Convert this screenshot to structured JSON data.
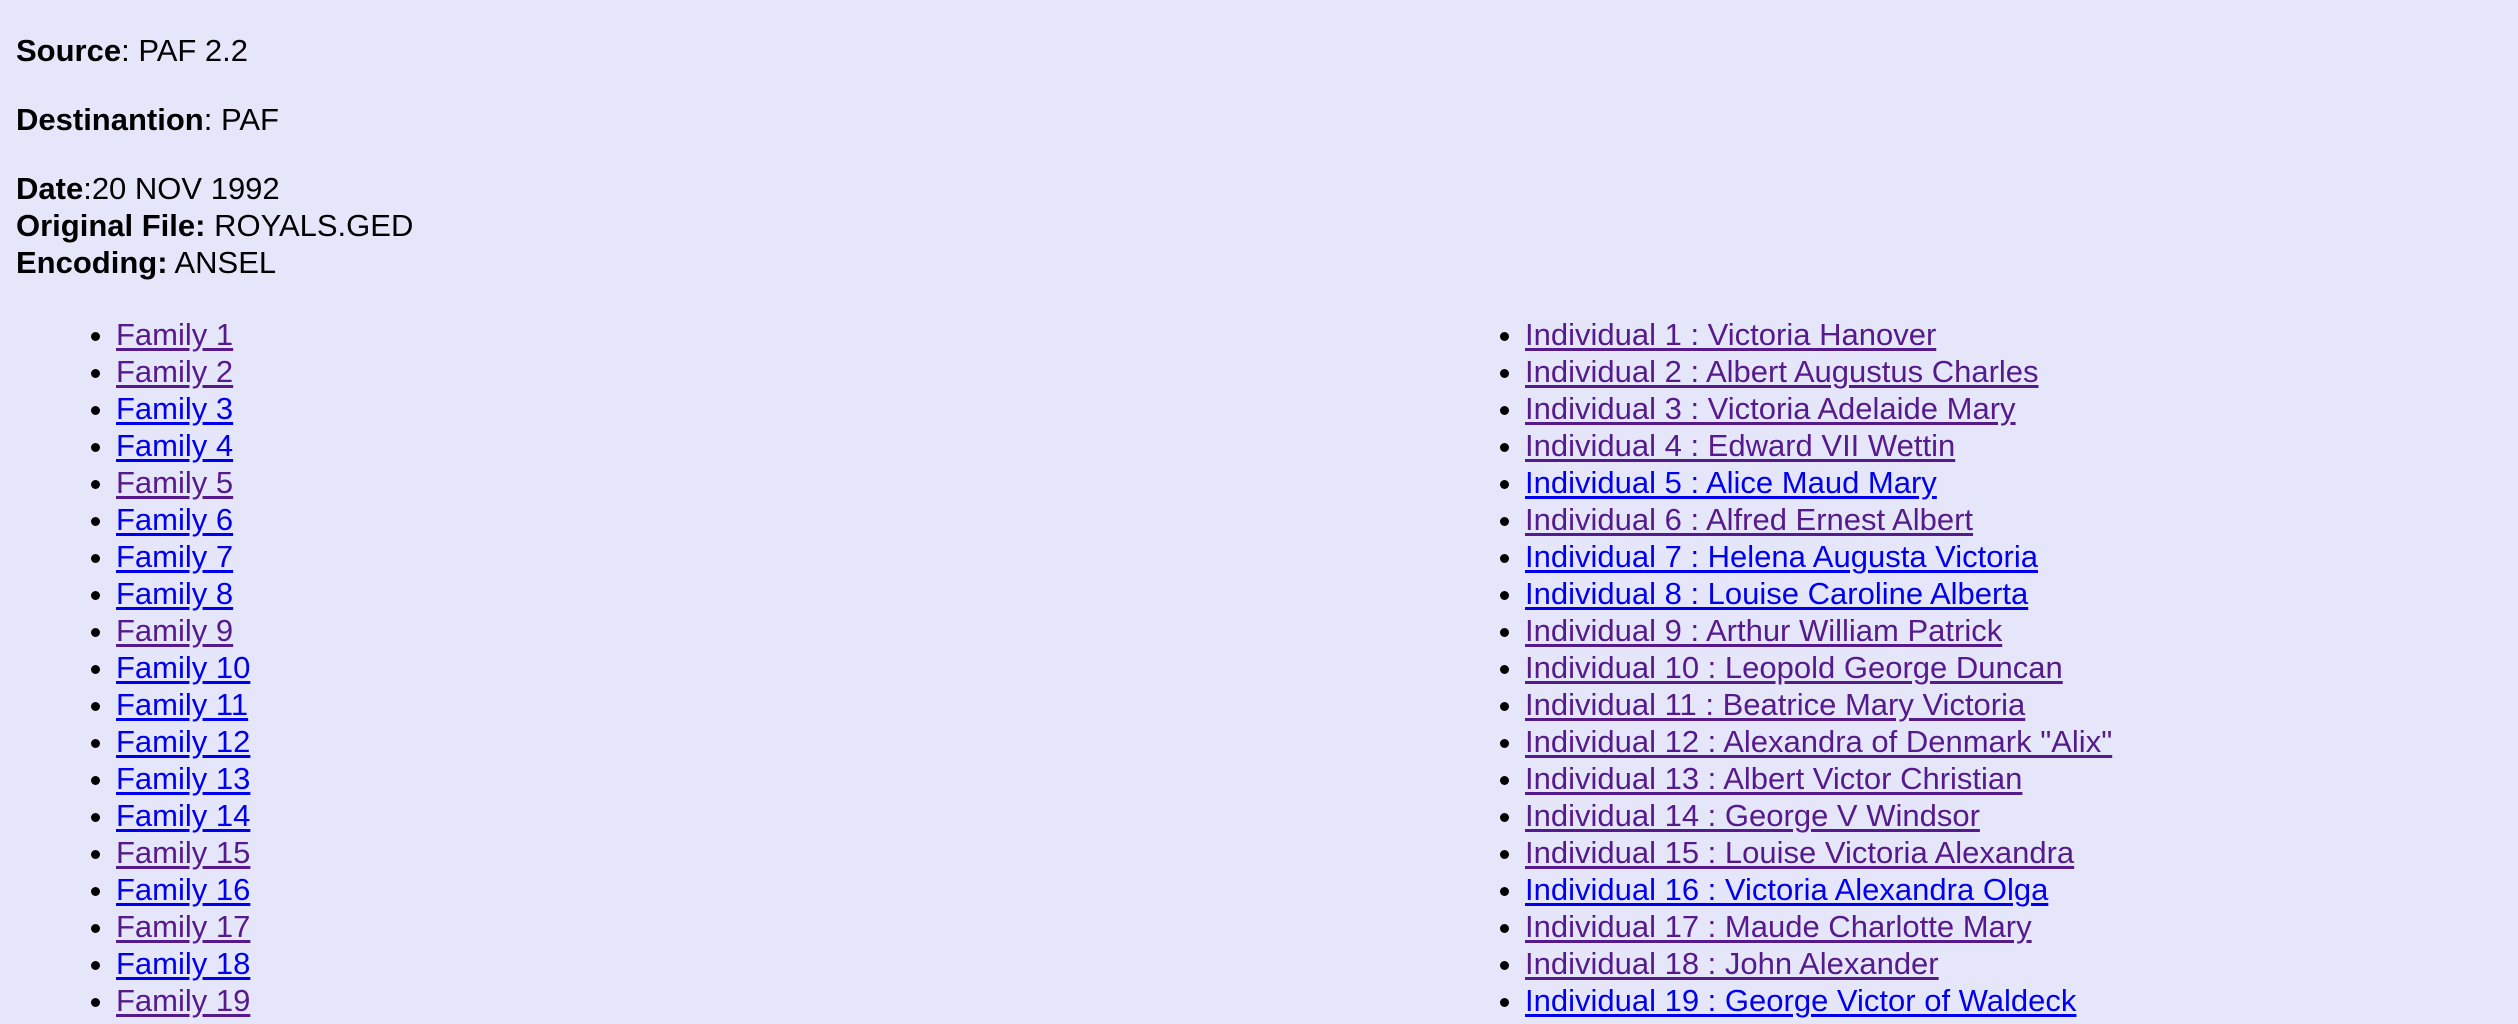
{
  "header": {
    "source_label": "Source",
    "source_value": ": PAF 2.2",
    "destination_label": "Destinantion",
    "destination_value": ": PAF",
    "date_label": "Date",
    "date_value": ":20 NOV 1992",
    "original_file_label": "Original File:",
    "original_file_value": " ROYALS.GED",
    "encoding_label": "Encoding:",
    "encoding_value": " ANSEL"
  },
  "colors": {
    "background": "#e6e6fa",
    "link_unvisited": "#0000ee",
    "link_visited": "#551a8b"
  },
  "families": [
    {
      "label": "Family 1",
      "visited": true
    },
    {
      "label": "Family 2",
      "visited": true
    },
    {
      "label": "Family 3",
      "visited": false
    },
    {
      "label": "Family 4",
      "visited": false
    },
    {
      "label": "Family 5",
      "visited": true
    },
    {
      "label": "Family 6",
      "visited": false
    },
    {
      "label": "Family 7",
      "visited": false
    },
    {
      "label": "Family 8",
      "visited": false
    },
    {
      "label": "Family 9",
      "visited": true
    },
    {
      "label": "Family 10",
      "visited": false
    },
    {
      "label": "Family 11",
      "visited": false
    },
    {
      "label": "Family 12",
      "visited": false
    },
    {
      "label": "Family 13",
      "visited": false
    },
    {
      "label": "Family 14",
      "visited": false
    },
    {
      "label": "Family 15",
      "visited": true
    },
    {
      "label": "Family 16",
      "visited": false
    },
    {
      "label": "Family 17",
      "visited": true
    },
    {
      "label": "Family 18",
      "visited": false
    },
    {
      "label": "Family 19",
      "visited": true
    }
  ],
  "individuals": [
    {
      "label": "Individual 1 : Victoria Hanover",
      "visited": true
    },
    {
      "label": "Individual 2 : Albert Augustus Charles",
      "visited": true
    },
    {
      "label": "Individual 3 : Victoria Adelaide Mary",
      "visited": true
    },
    {
      "label": "Individual 4 : Edward VII Wettin",
      "visited": true
    },
    {
      "label": "Individual 5 : Alice Maud Mary",
      "visited": false
    },
    {
      "label": "Individual 6 : Alfred Ernest Albert",
      "visited": true
    },
    {
      "label": "Individual 7 : Helena Augusta Victoria",
      "visited": false
    },
    {
      "label": "Individual 8 : Louise Caroline Alberta",
      "visited": false
    },
    {
      "label": "Individual 9 : Arthur William Patrick",
      "visited": true
    },
    {
      "label": "Individual 10 : Leopold George Duncan",
      "visited": true
    },
    {
      "label": "Individual 11 : Beatrice Mary Victoria",
      "visited": true
    },
    {
      "label": "Individual 12 : Alexandra of Denmark \"Alix\"",
      "visited": true
    },
    {
      "label": "Individual 13 : Albert Victor Christian",
      "visited": true
    },
    {
      "label": "Individual 14 : George V Windsor",
      "visited": true
    },
    {
      "label": "Individual 15 : Louise Victoria Alexandra",
      "visited": true
    },
    {
      "label": "Individual 16 : Victoria Alexandra Olga",
      "visited": false
    },
    {
      "label": "Individual 17 : Maude Charlotte Mary",
      "visited": true
    },
    {
      "label": "Individual 18 : John Alexander",
      "visited": true
    },
    {
      "label": "Individual 19 : George Victor of Waldeck",
      "visited": false
    }
  ]
}
